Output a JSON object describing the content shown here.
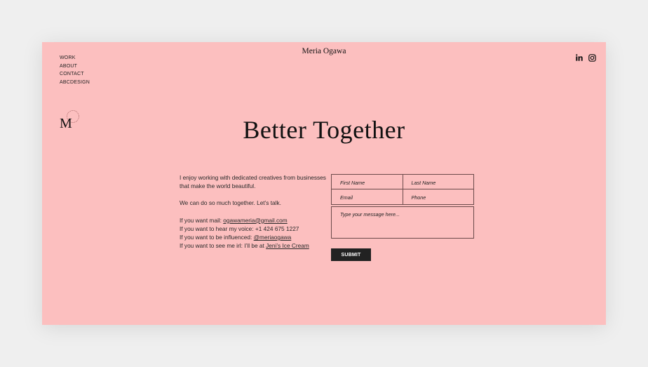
{
  "site": {
    "name": "Meria Ogawa"
  },
  "nav": {
    "items": [
      "WORK",
      "ABOUT",
      "CONTACT",
      "ABCDESIGN"
    ]
  },
  "social": {
    "icons": [
      "linkedin-icon",
      "instagram-icon"
    ]
  },
  "logo": {
    "letter": "M"
  },
  "headline": "Better Together",
  "intro": {
    "p1": "I enjoy working with dedicated creatives from businesses that make the world beautiful.",
    "p2": "We can do so much together. Let’s talk.",
    "mail_prefix": "If you want mail: ",
    "mail_link": "ogawameria@gmail.com",
    "voice": "If you want to hear my voice: +1 424 675 1227",
    "influence_prefix": "If you want to be influenced: ",
    "influence_link": "@meriaogawa",
    "irl_prefix": "If you want to see me irl: I’ll be at ",
    "irl_link": "Jeni’s Ice Cream"
  },
  "form": {
    "first_name": "First Name",
    "last_name": "Last Name",
    "email": "Email",
    "phone": "Phone",
    "message": "Type your message here...",
    "submit": "SUBMIT"
  },
  "colors": {
    "page_bg": "#fcbfbf",
    "outer_bg": "#efefef",
    "button_bg": "#222222"
  }
}
